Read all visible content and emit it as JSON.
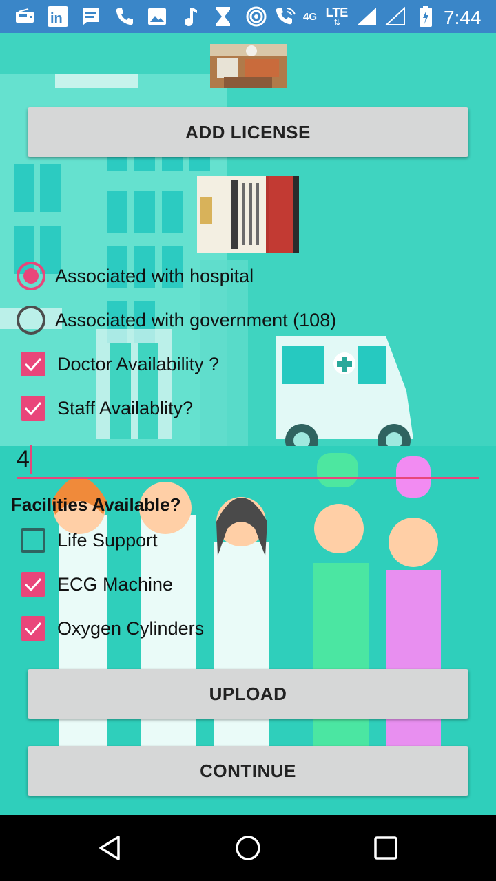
{
  "status_bar": {
    "time": "7:44",
    "network_4g": "4G",
    "network_lte": "LTE",
    "icons": [
      "radio-icon",
      "linkedin-icon",
      "message-icon",
      "phone-icon",
      "image-icon",
      "music-icon",
      "hourglass-icon",
      "hotspot-icon",
      "wifi-call-icon",
      "signal-icon",
      "signal-empty-icon",
      "battery-icon"
    ]
  },
  "buttons": {
    "add_license": "ADD LICENSE",
    "upload": "UPLOAD",
    "continue": "CONTINUE"
  },
  "association": {
    "options": [
      {
        "label": "Associated with hospital",
        "checked": true
      },
      {
        "label": "Associated with government (108)",
        "checked": false
      }
    ]
  },
  "availability": {
    "options": [
      {
        "label": "Doctor Availability ?",
        "checked": true
      },
      {
        "label": "Staff Availablity?",
        "checked": true
      }
    ]
  },
  "staff_count": {
    "value": "4"
  },
  "facilities": {
    "heading": "Facilities Available?",
    "options": [
      {
        "label": "Life Support",
        "checked": false
      },
      {
        "label": "ECG Machine",
        "checked": true
      },
      {
        "label": "Oxygen Cylinders",
        "checked": true
      }
    ]
  },
  "colors": {
    "accent": "#e9467a",
    "status_bar": "#3a86c8",
    "background": "#3fd4c0",
    "button": "#d6d7d7"
  },
  "navigation": {
    "icons": [
      "back-icon",
      "home-icon",
      "recents-icon"
    ]
  }
}
